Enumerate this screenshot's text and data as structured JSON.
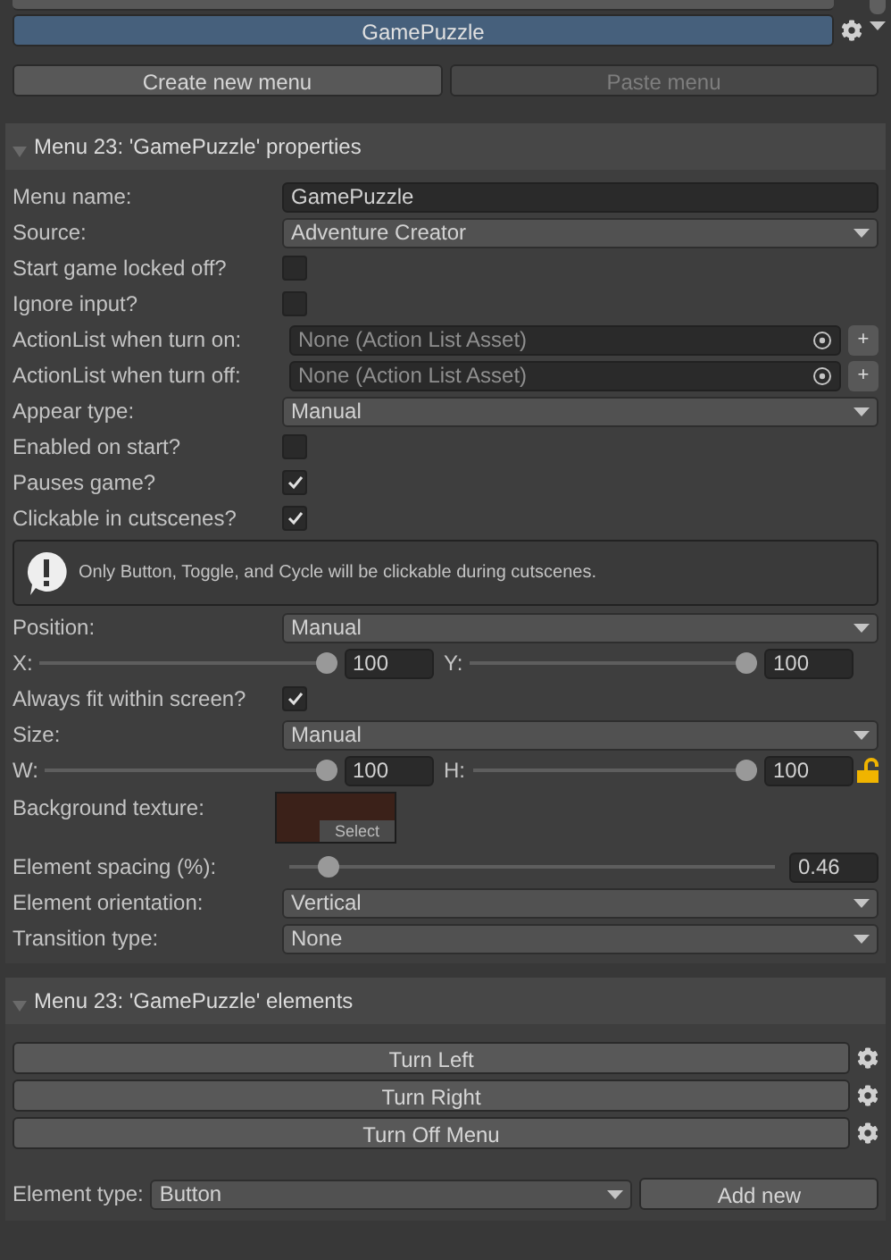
{
  "menu_list": {
    "items": [
      {
        "label": "GamePuzzle",
        "selected": true
      }
    ]
  },
  "menu_actions": [
    {
      "label": "Create new menu",
      "disabled": false
    },
    {
      "label": "Paste menu",
      "disabled": true
    }
  ],
  "properties": {
    "title": "Menu 23: 'GamePuzzle' properties",
    "expanded": true,
    "rows": [
      {
        "kind": "text",
        "label": "Menu name:",
        "value": "GamePuzzle"
      },
      {
        "kind": "dropdown",
        "label": "Source:",
        "value": "Adventure Creator"
      },
      {
        "kind": "checkbox",
        "label": "Start game locked off?",
        "checked": false
      },
      {
        "kind": "checkbox",
        "label": "Ignore input?",
        "checked": false
      },
      {
        "kind": "asset",
        "label": "ActionList when turn on:",
        "placeholder": "None (Action List Asset)",
        "button": "+"
      },
      {
        "kind": "asset",
        "label": "ActionList when turn off:",
        "placeholder": "None (Action List Asset)",
        "button": "+"
      },
      {
        "kind": "dropdown",
        "label": "Appear type:",
        "value": "Manual"
      },
      {
        "kind": "checkbox",
        "label": "Enabled on start?",
        "checked": false
      },
      {
        "kind": "checkbox",
        "label": "Pauses game?",
        "checked": true
      },
      {
        "kind": "checkbox",
        "label": "Clickable in cutscenes?",
        "checked": true
      },
      {
        "kind": "info",
        "text": "Only Button, Toggle, and Cycle will be clickable during cutscenes."
      },
      {
        "kind": "dropdown",
        "label": "Position:",
        "value": "Manual"
      },
      {
        "kind": "pair",
        "sliders": [
          {
            "label": "X:",
            "level": 1,
            "value": "100"
          },
          {
            "label": "Y:",
            "level": 1,
            "value": "100"
          }
        ]
      },
      {
        "kind": "checkbox",
        "label": "Always fit within screen?",
        "checked": true
      },
      {
        "kind": "dropdown",
        "label": "Size:",
        "value": "Manual"
      },
      {
        "kind": "pair",
        "locked": false,
        "sliders": [
          {
            "label": "W:",
            "level": 1,
            "value": "100"
          },
          {
            "label": "H:",
            "level": 1,
            "value": "100"
          }
        ]
      },
      {
        "kind": "texture",
        "label": "Background texture:",
        "button": "Select"
      },
      {
        "kind": "slider",
        "label": "Element spacing (%):",
        "level": 0.06,
        "value": "0.46"
      },
      {
        "kind": "dropdown",
        "label": "Element orientation:",
        "value": "Vertical"
      },
      {
        "kind": "dropdown",
        "label": "Transition type:",
        "value": "None"
      }
    ]
  },
  "elements": {
    "title": "Menu 23: 'GamePuzzle' elements",
    "expanded": true,
    "items": [
      {
        "label": "Turn Left"
      },
      {
        "label": "Turn Right"
      },
      {
        "label": "Turn Off Menu"
      }
    ],
    "type_label": "Element type:",
    "type_value": "Button",
    "add_button": "Add new"
  }
}
